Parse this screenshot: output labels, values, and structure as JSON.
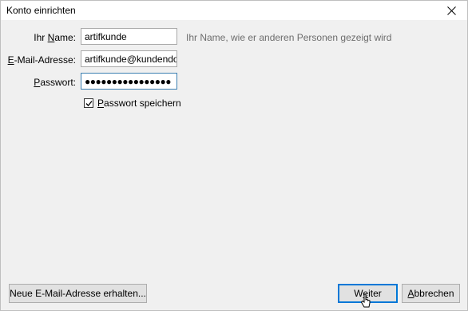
{
  "window": {
    "title": "Konto einrichten"
  },
  "form": {
    "name_label_prefix": "Ihr ",
    "name_label_underlined": "N",
    "name_label_suffix": "ame:",
    "name_value": "artifkunde",
    "name_hint": "Ihr Name, wie er anderen Personen gezeigt wird",
    "email_label_underlined": "E",
    "email_label_suffix": "-Mail-Adresse:",
    "email_value": "artifkunde@kundendo",
    "password_label_underlined": "P",
    "password_label_suffix": "asswort:",
    "password_value": "●●●●●●●●●●●●●●●●",
    "save_password_underlined": "P",
    "save_password_suffix": "asswort speichern",
    "save_password_checked": true
  },
  "buttons": {
    "new_email": "Neue E-Mail-Adresse erhalten...",
    "next_prefix": "W",
    "next_underlined": "e",
    "next_suffix": "iter",
    "cancel_underlined": "A",
    "cancel_suffix": "bbrechen"
  }
}
